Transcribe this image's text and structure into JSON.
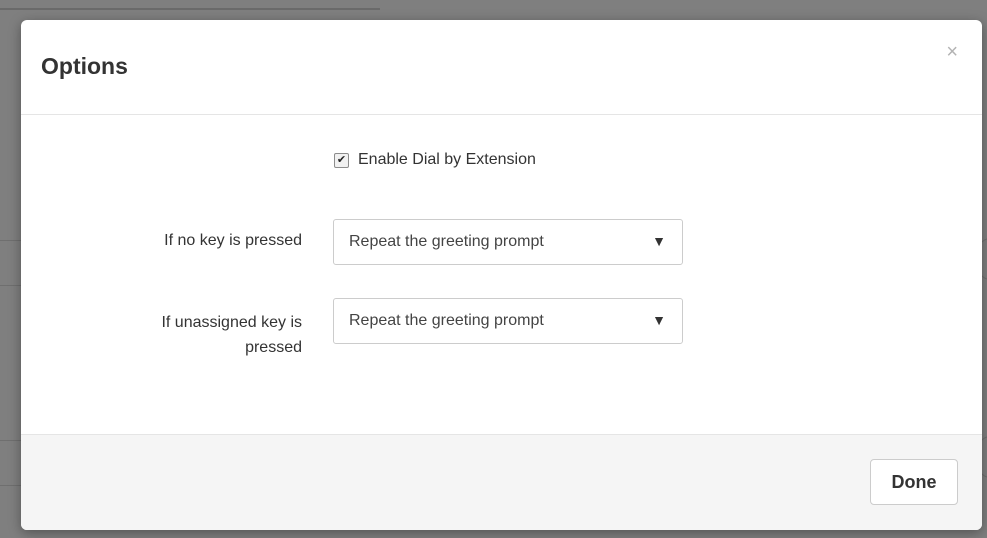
{
  "modal": {
    "title": "Options",
    "close_glyph": "×",
    "close_icon": "close-icon"
  },
  "dial_by_extension": {
    "checked": true,
    "label": "Enable Dial by Extension",
    "check_glyph": "✔"
  },
  "no_key_pressed": {
    "label": "If no key is pressed",
    "value": "Repeat the greeting prompt",
    "arrow_glyph": "▼"
  },
  "unassigned_key_pressed": {
    "label": "If unassigned key is pressed",
    "value": "Repeat the greeting prompt",
    "arrow_glyph": "▼"
  },
  "footer": {
    "done_label": "Done"
  },
  "colors": {
    "overlay": "#7f7f7f",
    "modal_bg": "#ffffff",
    "footer_bg": "#f5f5f5",
    "text": "#333333",
    "border": "#cccccc"
  }
}
